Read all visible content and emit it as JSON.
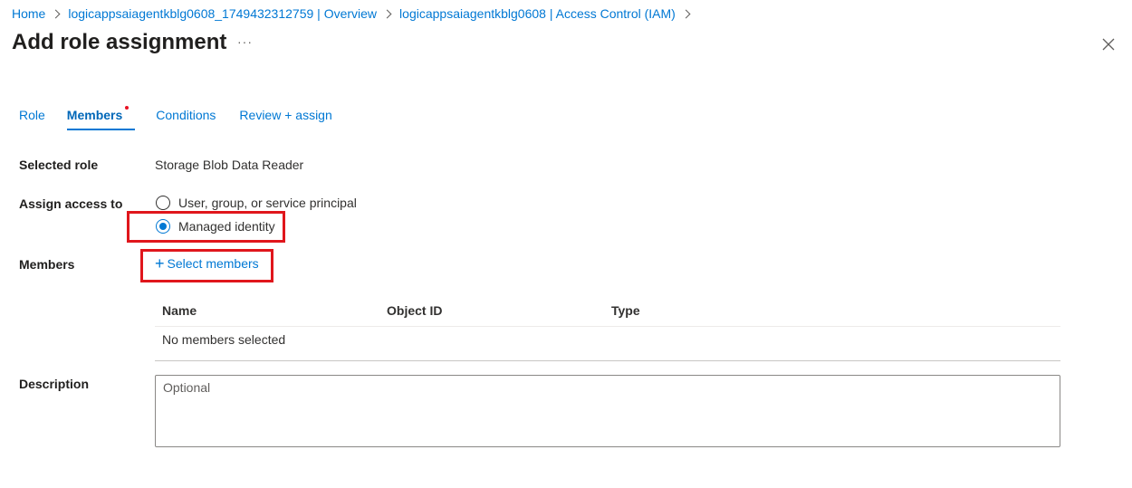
{
  "breadcrumb": [
    {
      "label": "Home"
    },
    {
      "label": "logicappsaiagentkblg0608_1749432312759 | Overview"
    },
    {
      "label": "logicappsaiagentkblg0608 | Access Control (IAM)"
    }
  ],
  "header": {
    "title": "Add role assignment",
    "more": "···"
  },
  "tabs": [
    {
      "label": "Role"
    },
    {
      "label": "Members"
    },
    {
      "label": "Conditions"
    },
    {
      "label": "Review + assign"
    }
  ],
  "selected_role": {
    "label": "Selected role",
    "value": "Storage Blob Data Reader"
  },
  "assign_access": {
    "label": "Assign access to",
    "options": [
      {
        "label": "User, group, or service principal",
        "checked": false
      },
      {
        "label": "Managed identity",
        "checked": true
      }
    ]
  },
  "members": {
    "label": "Members",
    "select_label": "Select members",
    "columns": [
      "Name",
      "Object ID",
      "Type"
    ],
    "empty_text": "No members selected"
  },
  "description": {
    "label": "Description",
    "placeholder": "Optional"
  },
  "colors": {
    "accent": "#0078d4",
    "highlight": "#e0161c",
    "required_dot": "#e81123"
  }
}
